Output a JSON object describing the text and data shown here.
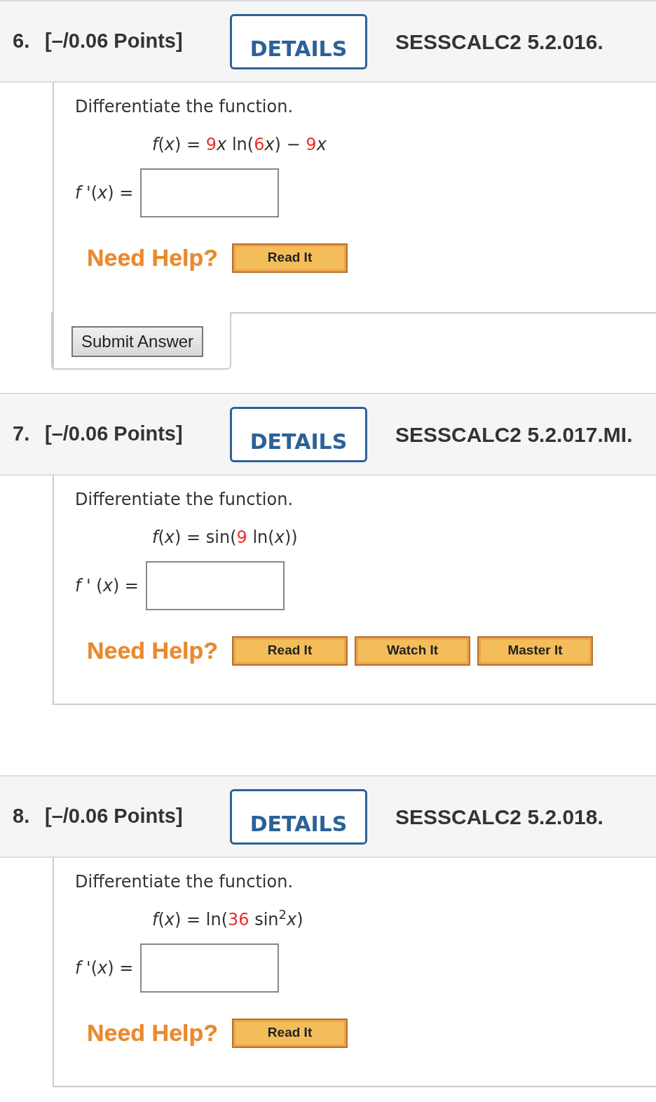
{
  "questions": [
    {
      "number": "6.",
      "points": "[–/0.06 Points]",
      "details_button": "DETAILS",
      "reference": "SESSCALC2 5.2.016.",
      "prompt": "Differentiate the function.",
      "formula": [
        {
          "kind": "italic",
          "text": "f"
        },
        {
          "kind": "plain",
          "text": "("
        },
        {
          "kind": "italic",
          "text": "x"
        },
        {
          "kind": "plain",
          "text": ") = "
        },
        {
          "kind": "number",
          "text": "9"
        },
        {
          "kind": "italic",
          "text": "x"
        },
        {
          "kind": "plain",
          "text": " ln("
        },
        {
          "kind": "number",
          "text": "6"
        },
        {
          "kind": "italic",
          "text": "x"
        },
        {
          "kind": "plain",
          "text": ") − "
        },
        {
          "kind": "number",
          "text": "9"
        },
        {
          "kind": "italic",
          "text": "x"
        }
      ],
      "answer_label": "*f* '(*x*) =",
      "help_label": "Need Help?",
      "help_buttons": [
        "Read It"
      ],
      "submit_button": "Submit Answer"
    },
    {
      "number": "7.",
      "points": "[–/0.06 Points]",
      "details_button": "DETAILS",
      "reference": "SESSCALC2 5.2.017.MI.",
      "prompt": "Differentiate the function.",
      "formula": [
        {
          "kind": "italic",
          "text": "f"
        },
        {
          "kind": "plain",
          "text": "("
        },
        {
          "kind": "italic",
          "text": "x"
        },
        {
          "kind": "plain",
          "text": ") = sin("
        },
        {
          "kind": "number",
          "text": "9"
        },
        {
          "kind": "plain",
          "text": " ln("
        },
        {
          "kind": "italic",
          "text": "x"
        },
        {
          "kind": "plain",
          "text": "))"
        }
      ],
      "answer_label": "*f* ' (*x*) =",
      "help_label": "Need Help?",
      "help_buttons": [
        "Read It",
        "Watch It",
        "Master It"
      ]
    },
    {
      "number": "8.",
      "points": "[–/0.06 Points]",
      "details_button": "DETAILS",
      "reference": "SESSCALC2 5.2.018.",
      "prompt": "Differentiate the function.",
      "formula": [
        {
          "kind": "italic",
          "text": "f"
        },
        {
          "kind": "plain",
          "text": "("
        },
        {
          "kind": "italic",
          "text": "x"
        },
        {
          "kind": "plain",
          "text": ") = ln("
        },
        {
          "kind": "number",
          "text": "36"
        },
        {
          "kind": "plain",
          "text": " sin"
        },
        {
          "kind": "sup",
          "text": "2"
        },
        {
          "kind": "italic",
          "text": "x"
        },
        {
          "kind": "plain",
          "text": ")"
        }
      ],
      "answer_label": "*f* '(*x*) =",
      "help_label": "Need Help?",
      "help_buttons": [
        "Read It"
      ]
    }
  ]
}
